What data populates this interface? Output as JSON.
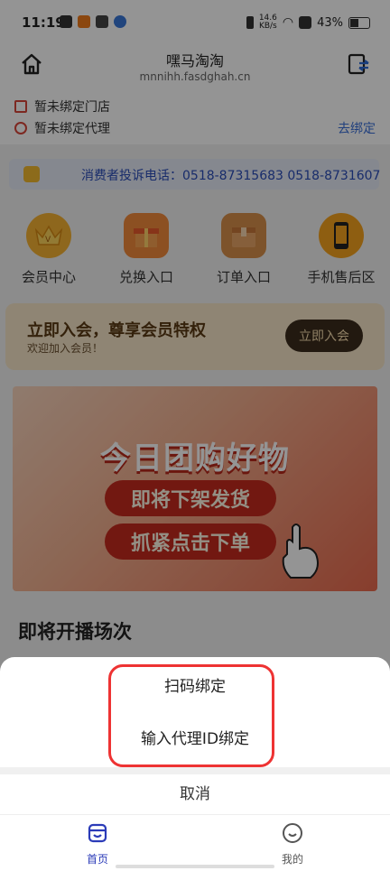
{
  "status_bar": {
    "time": "11:19",
    "net_speed_top": "14.6",
    "net_speed_unit": "KB/s",
    "battery": "43%"
  },
  "header": {
    "title": "嘿马淘淘",
    "subtitle": "mnnihh.fasdghah.cn"
  },
  "binding": {
    "store_status": "暂未绑定门店",
    "agent_status": "暂未绑定代理",
    "bind_link": "去绑定"
  },
  "hotline": {
    "text": "消费者投诉电话：0518-87315683 0518-8731607"
  },
  "quick_entries": [
    {
      "label": "会员中心",
      "icon": "crown-icon"
    },
    {
      "label": "兑换入口",
      "icon": "gift-icon"
    },
    {
      "label": "订单入口",
      "icon": "package-icon"
    },
    {
      "label": "手机售后区",
      "icon": "phone-icon"
    }
  ],
  "member_banner": {
    "title": "立即入会，尊享会员特权",
    "subtitle": "欢迎加入会员！",
    "button": "立即入会"
  },
  "promo": {
    "headline": "今日团购好物",
    "line1": "即将下架发货",
    "line2": "抓紧点击下单"
  },
  "section": {
    "title": "即将开播场次"
  },
  "action_sheet": {
    "option_scan": "扫码绑定",
    "option_input": "输入代理ID绑定",
    "cancel": "取消"
  },
  "tabbar": {
    "home": "首页",
    "mine": "我的"
  },
  "colors": {
    "accent": "#3a6fd8",
    "highlight": "#e33333",
    "tab_active": "#2b3bb8"
  }
}
